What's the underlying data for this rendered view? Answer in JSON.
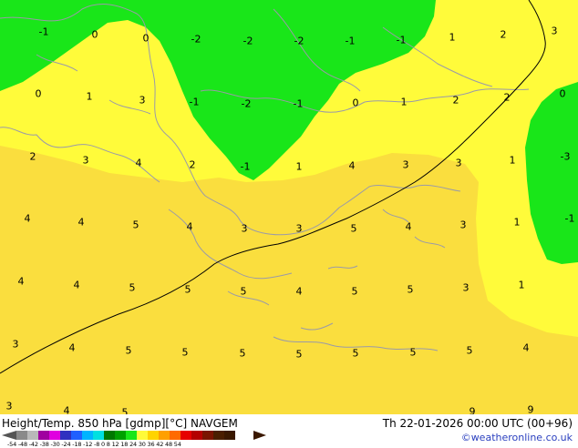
{
  "map": {
    "colors": {
      "green_zone": "#19e619",
      "light_yellow_zone": "#fffb3a",
      "warm_yellow_zone": "#fade3e",
      "coastline": "#9a9aa8",
      "track_line": "#000000"
    },
    "labels": [
      {
        "id": "l01",
        "text": "-1"
      },
      {
        "id": "l02",
        "text": "0"
      },
      {
        "id": "l03",
        "text": "0"
      },
      {
        "id": "l04",
        "text": "-2"
      },
      {
        "id": "l05",
        "text": "-2"
      },
      {
        "id": "l06",
        "text": "-2"
      },
      {
        "id": "l07",
        "text": "-1"
      },
      {
        "id": "l08",
        "text": "-1"
      },
      {
        "id": "l09",
        "text": "1"
      },
      {
        "id": "l10",
        "text": "2"
      },
      {
        "id": "l11",
        "text": "3"
      },
      {
        "id": "l12",
        "text": "0"
      },
      {
        "id": "l13",
        "text": "1"
      },
      {
        "id": "l14",
        "text": "3"
      },
      {
        "id": "l15",
        "text": "-1"
      },
      {
        "id": "l16",
        "text": "-2"
      },
      {
        "id": "l17",
        "text": "-1"
      },
      {
        "id": "l18",
        "text": "0"
      },
      {
        "id": "l19",
        "text": "1"
      },
      {
        "id": "l20",
        "text": "2"
      },
      {
        "id": "l21",
        "text": "2"
      },
      {
        "id": "l22",
        "text": "0"
      },
      {
        "id": "l23",
        "text": "2"
      },
      {
        "id": "l24",
        "text": "3"
      },
      {
        "id": "l25",
        "text": "4"
      },
      {
        "id": "l26",
        "text": "2"
      },
      {
        "id": "l27",
        "text": "-1"
      },
      {
        "id": "l28",
        "text": "1"
      },
      {
        "id": "l29",
        "text": "4"
      },
      {
        "id": "l30",
        "text": "3"
      },
      {
        "id": "l31",
        "text": "3"
      },
      {
        "id": "l32",
        "text": "1"
      },
      {
        "id": "l33",
        "text": "-3"
      },
      {
        "id": "l34",
        "text": "4"
      },
      {
        "id": "l35",
        "text": "4"
      },
      {
        "id": "l36",
        "text": "5"
      },
      {
        "id": "l37",
        "text": "4"
      },
      {
        "id": "l38",
        "text": "3"
      },
      {
        "id": "l39",
        "text": "3"
      },
      {
        "id": "l40",
        "text": "5"
      },
      {
        "id": "l41",
        "text": "4"
      },
      {
        "id": "l42",
        "text": "3"
      },
      {
        "id": "l43",
        "text": "1"
      },
      {
        "id": "l44",
        "text": "-1"
      },
      {
        "id": "l45",
        "text": "4"
      },
      {
        "id": "l46",
        "text": "4"
      },
      {
        "id": "l47",
        "text": "5"
      },
      {
        "id": "l48",
        "text": "5"
      },
      {
        "id": "l49",
        "text": "5"
      },
      {
        "id": "l50",
        "text": "4"
      },
      {
        "id": "l51",
        "text": "5"
      },
      {
        "id": "l52",
        "text": "5"
      },
      {
        "id": "l53",
        "text": "3"
      },
      {
        "id": "l54",
        "text": "1"
      },
      {
        "id": "l55",
        "text": "3"
      },
      {
        "id": "l56",
        "text": "4"
      },
      {
        "id": "l57",
        "text": "5"
      },
      {
        "id": "l58",
        "text": "5"
      },
      {
        "id": "l59",
        "text": "5"
      },
      {
        "id": "l60",
        "text": "5"
      },
      {
        "id": "l61",
        "text": "5"
      },
      {
        "id": "l62",
        "text": "5"
      },
      {
        "id": "l63",
        "text": "5"
      },
      {
        "id": "l64",
        "text": "4"
      },
      {
        "id": "l65",
        "text": "3"
      },
      {
        "id": "l66",
        "text": "4"
      },
      {
        "id": "l67",
        "text": "5"
      },
      {
        "id": "l68",
        "text": "9"
      },
      {
        "id": "l69",
        "text": "9"
      }
    ]
  },
  "footer": {
    "title": "Height/Temp. 850 hPa [gdmp][°C] NAVGEM",
    "datetime": "Th 22-01-2026 00:00 UTC (00+96)",
    "credit": "©weatheronline.co.uk",
    "legend_ticks": "-54 -48 -42 -38 -30 -24 -18 -12 -8  0  8  12  18  24  30  36  42  48  54",
    "legend_colors": [
      "#8a8a8a",
      "#b9b9b9",
      "#a000a0",
      "#e000e0",
      "#3030c0",
      "#2060ff",
      "#00b4ff",
      "#00e0e0",
      "#007800",
      "#00a000",
      "#19e619",
      "#fffb3a",
      "#ffd400",
      "#ffa000",
      "#ff6a00",
      "#e60000",
      "#b40000",
      "#7a1400",
      "#4a1e00",
      "#3a1800"
    ]
  }
}
